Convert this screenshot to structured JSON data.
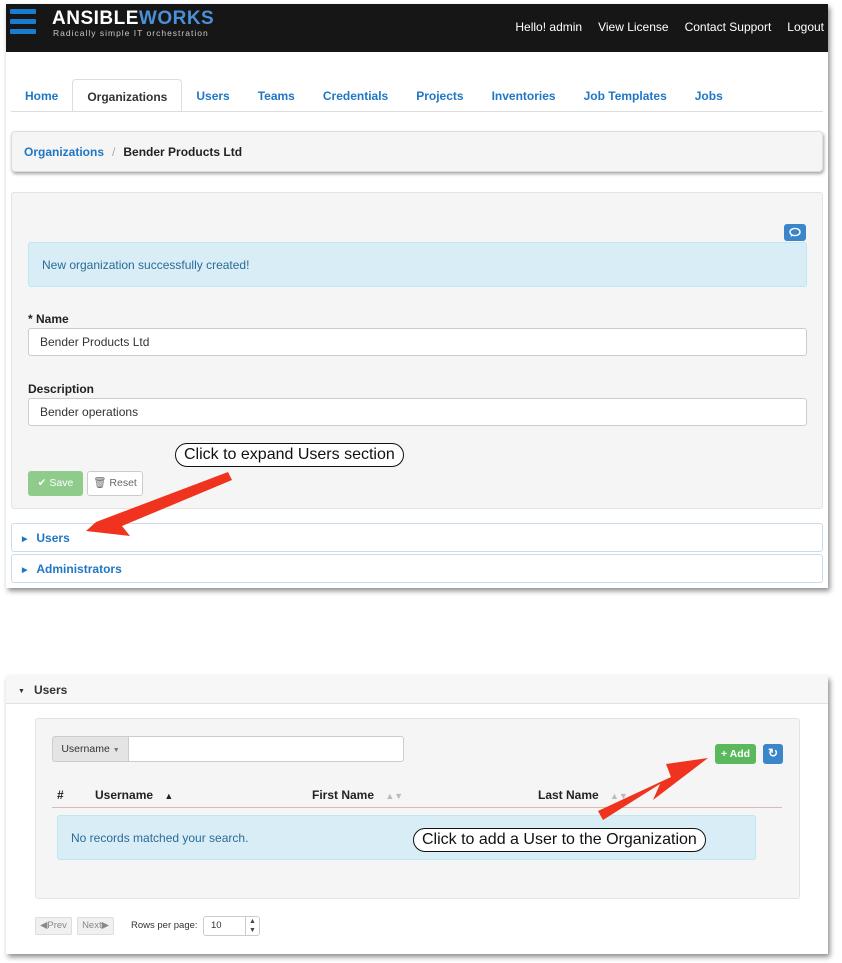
{
  "colors": {
    "accent_blue": "#1f77c4",
    "topbar": "#161616",
    "success_green": "#5cb85c",
    "alert_bg": "#d9edf7",
    "arrow_red": "#f0331f"
  },
  "header": {
    "brand_ansible": "ANSIBLE",
    "brand_works": "WORKS",
    "tagline": "Radically simple IT orchestration",
    "greeting": "Hello! admin",
    "view_license": "View License",
    "contact_support": "Contact Support",
    "logout": "Logout"
  },
  "tabs": [
    {
      "label": "Home"
    },
    {
      "label": "Organizations"
    },
    {
      "label": "Users"
    },
    {
      "label": "Teams"
    },
    {
      "label": "Credentials"
    },
    {
      "label": "Projects"
    },
    {
      "label": "Inventories"
    },
    {
      "label": "Job Templates"
    },
    {
      "label": "Jobs"
    }
  ],
  "breadcrumb": {
    "parent": "Organizations",
    "separator": "/",
    "current": "Bender Products Ltd"
  },
  "form": {
    "alert": "New organization successfully created!",
    "name_label": "* Name",
    "name_value": "Bender Products Ltd",
    "description_label": "Description",
    "description_value": "Bender operations",
    "save_label": "Save",
    "reset_label": "Reset"
  },
  "accordion": {
    "users_label": "Users",
    "admins_label": "Administrators"
  },
  "callouts": {
    "expand_users": "Click to expand Users section",
    "add_user": "Click to add a User to the Organization"
  },
  "users_panel": {
    "title": "Users",
    "search_field": "Username",
    "search_value": "",
    "add_label": "Add",
    "columns": [
      "#",
      "Username",
      "First Name",
      "Last Name"
    ],
    "empty_message": "No records matched your search.",
    "prev_label": "Prev",
    "next_label": "Next",
    "rows_per_page_label": "Rows per page:",
    "rows_per_page_value": "10"
  }
}
